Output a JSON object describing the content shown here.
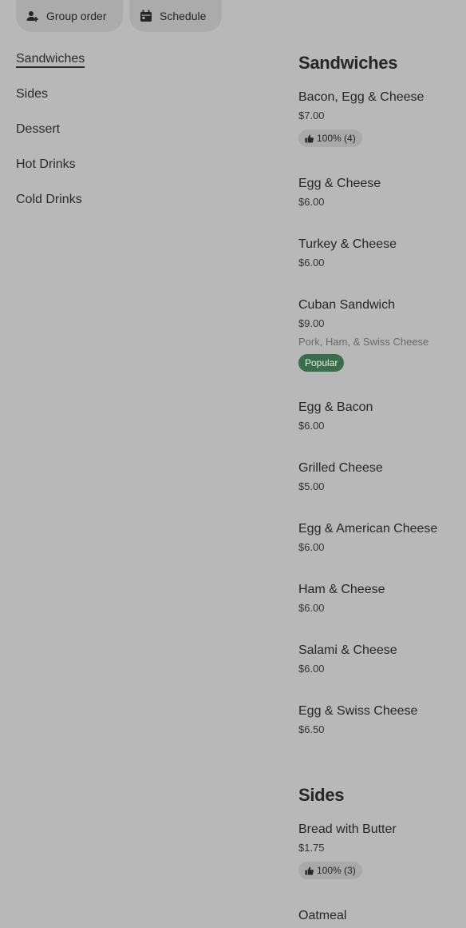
{
  "top_actions": {
    "group_order_label": "Group order",
    "schedule_label": "Schedule"
  },
  "nav": {
    "items": [
      {
        "label": "Sandwiches",
        "active": true
      },
      {
        "label": "Sides"
      },
      {
        "label": "Dessert"
      },
      {
        "label": "Hot Drinks"
      },
      {
        "label": "Cold Drinks"
      }
    ]
  },
  "menu": {
    "sandwiches": {
      "title": "Sandwiches",
      "items": [
        {
          "name": "Bacon, Egg & Cheese",
          "price": "$7.00",
          "rating": "100% (4)"
        },
        {
          "name": "Egg & Cheese",
          "price": "$6.00"
        },
        {
          "name": "Turkey & Cheese",
          "price": "$6.00"
        },
        {
          "name": "Cuban Sandwich",
          "price": "$9.00",
          "description": "Pork, Ham, & Swiss Cheese",
          "badge": "Popular"
        },
        {
          "name": "Egg & Bacon",
          "price": "$6.00"
        },
        {
          "name": "Grilled Cheese",
          "price": "$5.00"
        },
        {
          "name": "Egg & American Cheese",
          "price": "$6.00"
        },
        {
          "name": "Ham & Cheese",
          "price": "$6.00"
        },
        {
          "name": "Salami & Cheese",
          "price": "$6.00"
        },
        {
          "name": "Egg & Swiss Cheese",
          "price": "$6.50"
        }
      ]
    },
    "sides": {
      "title": "Sides",
      "items": [
        {
          "name": "Bread with Butter",
          "price": "$1.75",
          "rating": "100% (3)"
        },
        {
          "name": "Oatmeal"
        }
      ]
    }
  },
  "colors": {
    "background": "#b8b8b8",
    "popular_badge": "#3a6d4a"
  }
}
